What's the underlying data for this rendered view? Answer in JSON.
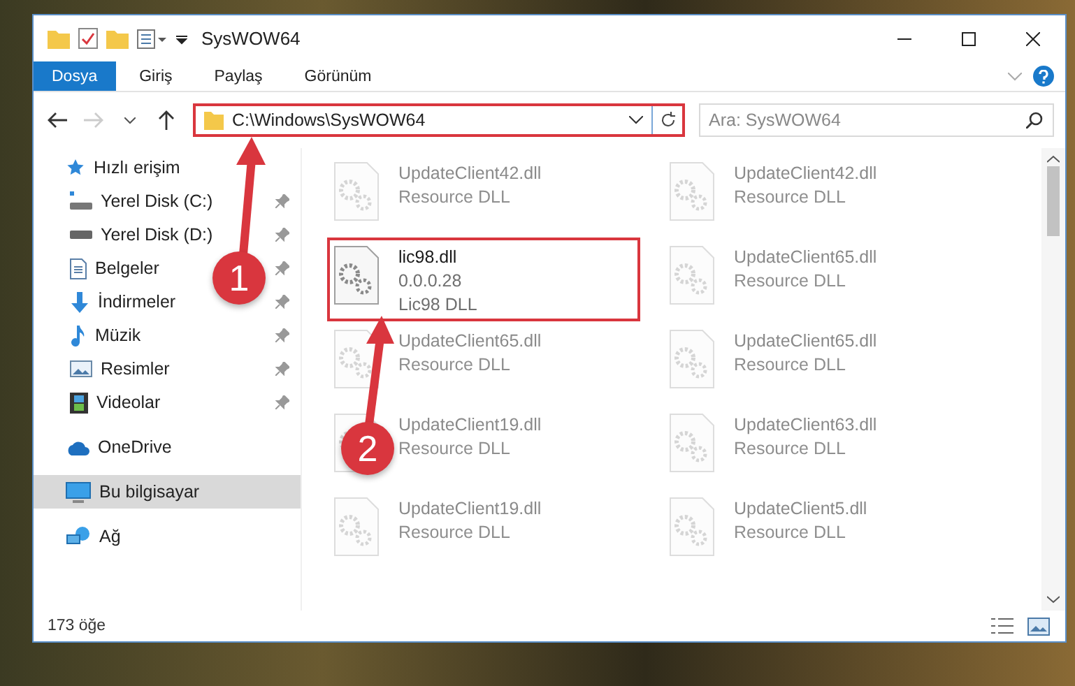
{
  "window": {
    "title": "SysWOW64"
  },
  "ribbon_tabs": [
    {
      "label": "Dosya",
      "selected": true
    },
    {
      "label": "Giriş",
      "selected": false
    },
    {
      "label": "Paylaş",
      "selected": false
    },
    {
      "label": "Görünüm",
      "selected": false
    }
  ],
  "address": {
    "path": "C:\\Windows\\SysWOW64",
    "highlighted": true
  },
  "search": {
    "placeholder": "Ara: SysWOW64"
  },
  "sidebar": {
    "items": [
      {
        "label": "Hızlı erişim",
        "selected": false,
        "children": [
          {
            "label": "Yerel Disk (C:)",
            "pinned": true
          },
          {
            "label": "Yerel Disk (D:)",
            "pinned": true
          },
          {
            "label": "Belgeler",
            "pinned": true
          },
          {
            "label": "İndirmeler",
            "pinned": true
          },
          {
            "label": "Müzik",
            "pinned": true
          },
          {
            "label": "Resimler",
            "pinned": true
          },
          {
            "label": "Videolar",
            "pinned": true
          }
        ]
      },
      {
        "label": "OneDrive",
        "selected": false
      },
      {
        "label": "Bu bilgisayar",
        "selected": true
      },
      {
        "label": "Ağ",
        "selected": false
      }
    ]
  },
  "files": [
    {
      "name": "UpdateClient42.dll",
      "details": [
        "Resource DLL"
      ],
      "kind": "faded",
      "highlighted": false
    },
    {
      "name": "UpdateClient42.dll",
      "details": [
        "Resource DLL"
      ],
      "kind": "faded",
      "highlighted": false
    },
    {
      "name": "lic98.dll",
      "details": [
        "0.0.0.28",
        "Lic98 DLL"
      ],
      "kind": "clear",
      "highlighted": true
    },
    {
      "name": "UpdateClient65.dll",
      "details": [
        "Resource DLL"
      ],
      "kind": "faded",
      "highlighted": false
    },
    {
      "name": "UpdateClient65.dll",
      "details": [
        "Resource DLL"
      ],
      "kind": "faded",
      "highlighted": false
    },
    {
      "name": "UpdateClient65.dll",
      "details": [
        "Resource DLL"
      ],
      "kind": "faded",
      "highlighted": false
    },
    {
      "name": "UpdateClient19.dll",
      "details": [
        "Resource DLL"
      ],
      "kind": "faded",
      "highlighted": false
    },
    {
      "name": "UpdateClient63.dll",
      "details": [
        "Resource DLL"
      ],
      "kind": "faded",
      "highlighted": false
    },
    {
      "name": "UpdateClient19.dll",
      "details": [
        "Resource DLL"
      ],
      "kind": "faded",
      "highlighted": false
    },
    {
      "name": "UpdateClient5.dll",
      "details": [
        "Resource DLL"
      ],
      "kind": "faded",
      "highlighted": false
    }
  ],
  "status_bar": {
    "count": "173 öğe"
  },
  "callouts": [
    {
      "number": "1"
    },
    {
      "number": "2"
    }
  ]
}
